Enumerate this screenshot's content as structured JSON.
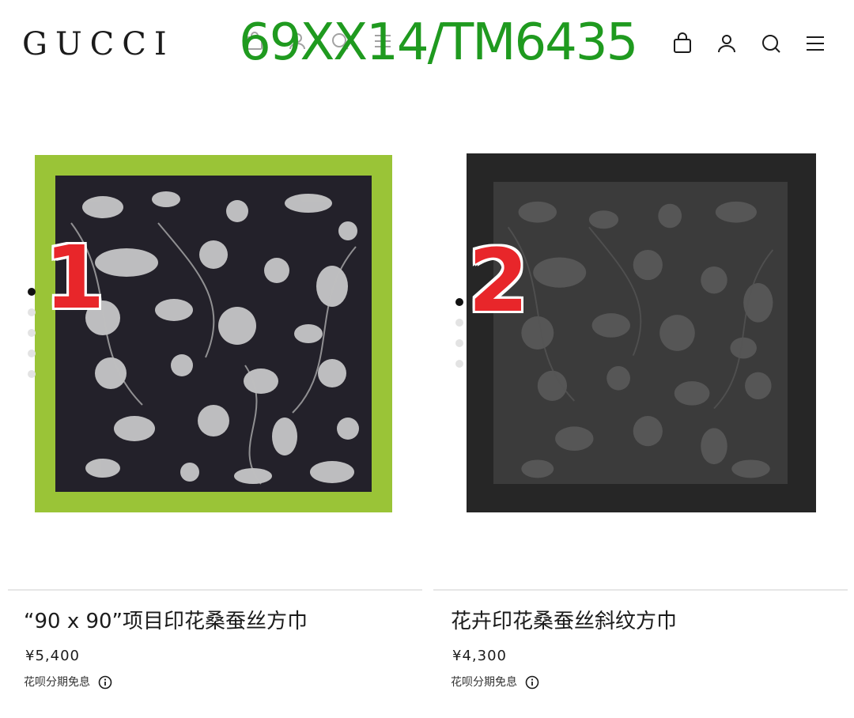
{
  "header": {
    "logo": "GUCCI",
    "watermark": "69XX14/TM6435",
    "icons": [
      "shopping-bag-icon",
      "user-icon",
      "search-icon",
      "menu-icon"
    ]
  },
  "products": [
    {
      "badge": "1",
      "name": "“90 x 90”项目印花桑蚕丝方巾",
      "price": "¥5,400",
      "installment": "花呗分期免息",
      "carousel": {
        "count": 5,
        "active": 1
      },
      "colors": {
        "border": "#9ac437",
        "field": "#23212a"
      }
    },
    {
      "badge": "2",
      "name": "花卉印花桑蚕丝斜纹方巾",
      "price": "¥4,300",
      "installment": "花呗分期免息",
      "carousel": {
        "count": 4,
        "active": 1
      },
      "colors": {
        "border": "#262626",
        "field": "#3b3b3b"
      }
    }
  ]
}
